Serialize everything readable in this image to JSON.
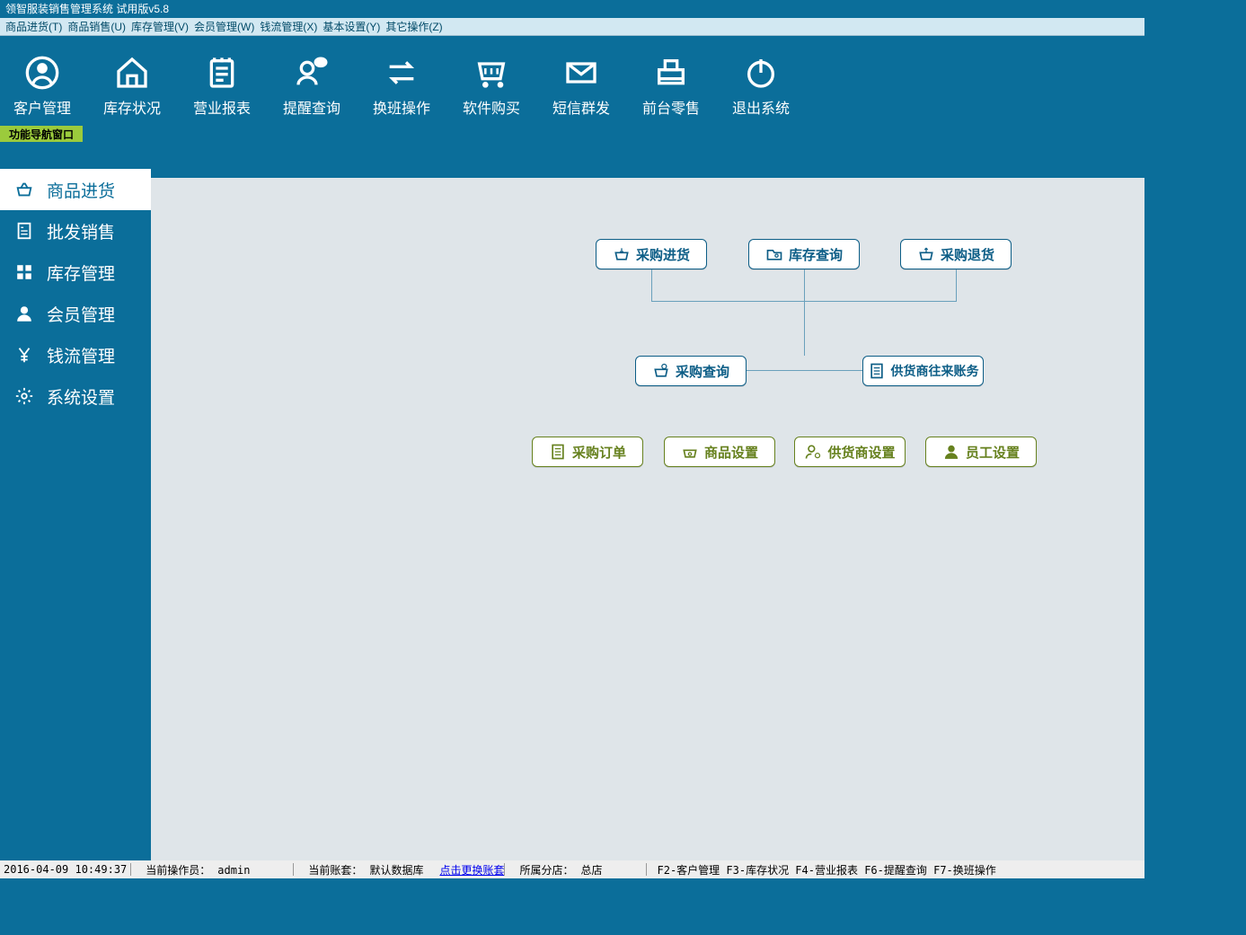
{
  "title": "领智服装销售管理系统 试用版v5.8",
  "menu": {
    "m0": "商品进货(T)",
    "m1": "商品销售(U)",
    "m2": "库存管理(V)",
    "m3": "会员管理(W)",
    "m4": "钱流管理(X)",
    "m5": "基本设置(Y)",
    "m6": "其它操作(Z)"
  },
  "toolbar": {
    "t0": "客户管理",
    "t1": "库存状况",
    "t2": "营业报表",
    "t3": "提醒查询",
    "t4": "换班操作",
    "t5": "软件购买",
    "t6": "短信群发",
    "t7": "前台零售",
    "t8": "退出系统"
  },
  "tab": "功能导航窗口",
  "sidebar": {
    "s0": "商品进货",
    "s1": "批发销售",
    "s2": "库存管理",
    "s3": "会员管理",
    "s4": "钱流管理",
    "s5": "系统设置"
  },
  "flow": {
    "f1": "采购进货",
    "f2": "库存查询",
    "f3": "采购退货",
    "f4": "采购查询",
    "f5": "供货商往来账务",
    "g1": "采购订单",
    "g2": "商品设置",
    "g3": "供货商设置",
    "g4": "员工设置"
  },
  "status": {
    "datetime": "2016-04-09 10:49:37",
    "operator_lbl": "当前操作员：",
    "operator": "admin",
    "account_lbl": "当前账套：",
    "account": "默认数据库",
    "switch": "点击更换账套",
    "branch_lbl": "所属分店：",
    "branch": "总店",
    "shortcuts": "F2-客户管理 F3-库存状况 F4-营业报表 F6-提醒查询 F7-换班操作"
  }
}
